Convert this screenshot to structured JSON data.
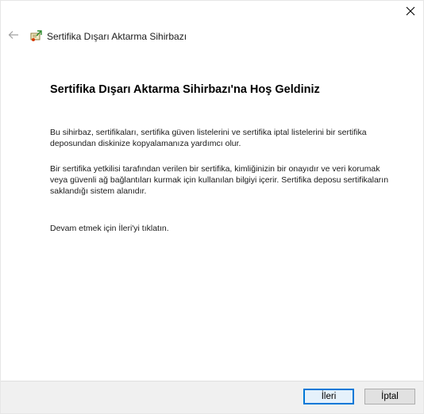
{
  "window": {
    "title": "Sertifika Dışarı Aktarma Sihirbazı"
  },
  "icons": {
    "close": "close-icon",
    "back": "back-arrow-icon",
    "app": "certificate-wizard-icon"
  },
  "main": {
    "heading": "Sertifika Dışarı Aktarma Sihirbazı'na Hoş Geldiniz",
    "paragraph1": "Bu sihirbaz, sertifikaları, sertifika güven listelerini ve sertifika iptal listelerini bir sertifika deposundan diskinize kopyalamanıza yardımcı olur.",
    "paragraph2": "Bir sertifika yetkilisi tarafından verilen bir sertifika, kimliğinizin bir onayıdır ve veri korumak veya güvenli ağ bağlantıları kurmak için kullanılan bilgiyi içerir. Sertifika deposu sertifikaların saklandığı sistem alanıdır.",
    "paragraph3": "Devam etmek için İleri'yi tıklatın."
  },
  "buttons": {
    "next": "İleri",
    "cancel": "İptal"
  },
  "colors": {
    "accent": "#0078d7",
    "footer_bg": "#f0f0f0"
  }
}
